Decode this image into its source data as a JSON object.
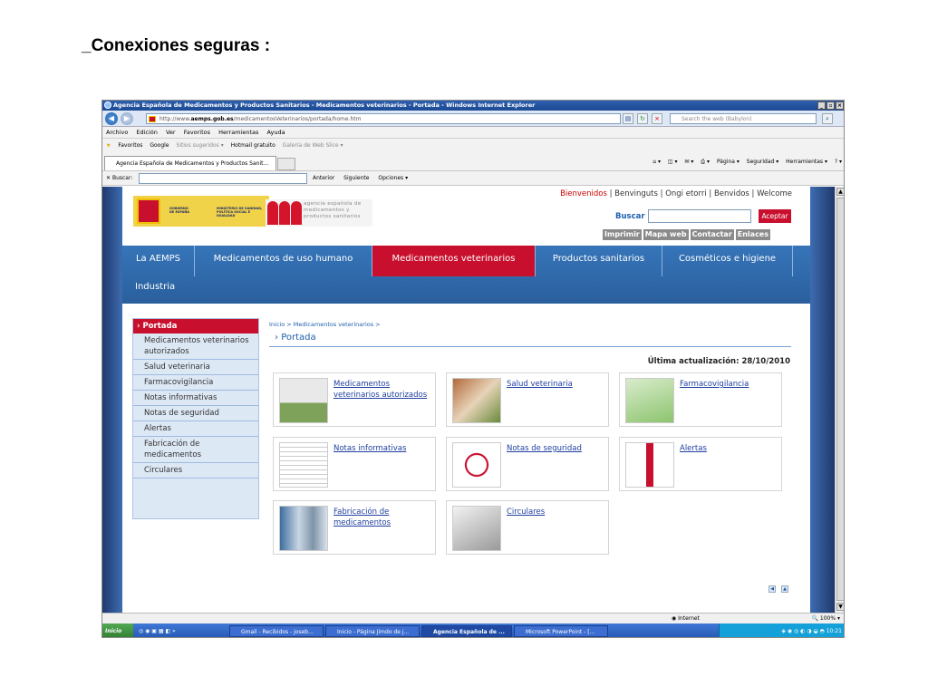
{
  "slide_title": "_Conexiones seguras :",
  "browser": {
    "window_title": "Agencia Española de Medicamentos y Productos Sanitarios - Medicamentos veterinarios - Portada - Windows Internet Explorer",
    "url_prefix": "http://www.",
    "url_domain": "aemps.gob.es",
    "url_path": "/medicamentosVeterinarios/portada/home.htm",
    "search_placeholder": "Search the web (Babylon)",
    "menu": [
      "Archivo",
      "Edición",
      "Ver",
      "Favoritos",
      "Herramientas",
      "Ayuda"
    ],
    "favorites_bar": [
      "Favoritos",
      "Google",
      "Sitios sugeridos ▾",
      "Hotmail gratuito",
      "Galería de Web Slice ▾"
    ],
    "tab_title": "Agencia Española de Medicamentos y Productos Sanit...",
    "command_bar": [
      "Página ▾",
      "Seguridad ▾",
      "Herramientas ▾"
    ],
    "find_label": "Buscar:",
    "find_prev": "Anterior",
    "find_next": "Siguiente",
    "find_options": "Opciones ▾"
  },
  "site": {
    "logo_gov_text": "GOBIERNO DE ESPAÑA",
    "logo_ministry_text": "MINISTERIO DE SANIDAD, POLÍTICA SOCIAL E IGUALDAD",
    "logo_agency_text": [
      "agencia española de",
      "medicamentos y",
      "productos sanitarios"
    ],
    "welcome_first": "Bienvenidos",
    "welcome_rest": " | Benvinguts | Ongi etorri | Benvidos | Welcome",
    "search_label": "Buscar",
    "search_button": "Aceptar",
    "utility_links": [
      "Imprimir",
      "Mapa web",
      "Contactar",
      "Enlaces"
    ],
    "nav": [
      "La AEMPS",
      "Medicamentos de uso humano",
      "Medicamentos veterinarios",
      "Productos sanitarios",
      "Cosméticos e higiene",
      "Industria"
    ],
    "sidebar": [
      "Portada",
      "Medicamentos veterinarios autorizados",
      "Salud veterinaria",
      "Farmacovigilancia",
      "Notas informativas",
      "Notas de seguridad",
      "Alertas",
      "Fabricación de medicamentos",
      "Circulares"
    ],
    "breadcrumb": "Inicio > Medicamentos veterinarios >",
    "page_title": "Portada",
    "last_update": "Última actualización: 28/10/2010",
    "cards": [
      "Medicamentos veterinarios autorizados",
      "Salud veterinaria",
      "Farmacovigilancia",
      "Notas informativas",
      "Notas de seguridad",
      "Alertas",
      "Fabricación de medicamentos",
      "Circulares"
    ]
  },
  "status": {
    "zone": "Internet",
    "zoom": "100%"
  },
  "taskbar": {
    "start": "Inicio",
    "tasks": [
      "Gmail - Recibidos - joseb...",
      "Inicio - Página Jimdo de j...",
      "Agencia Española de ...",
      "Microsoft PowerPoint - [..."
    ],
    "clock": "10:21"
  },
  "colors": {
    "accent_red": "#c8102e",
    "nav_blue": "#2f6bad",
    "link_blue": "#1f3f9f"
  }
}
